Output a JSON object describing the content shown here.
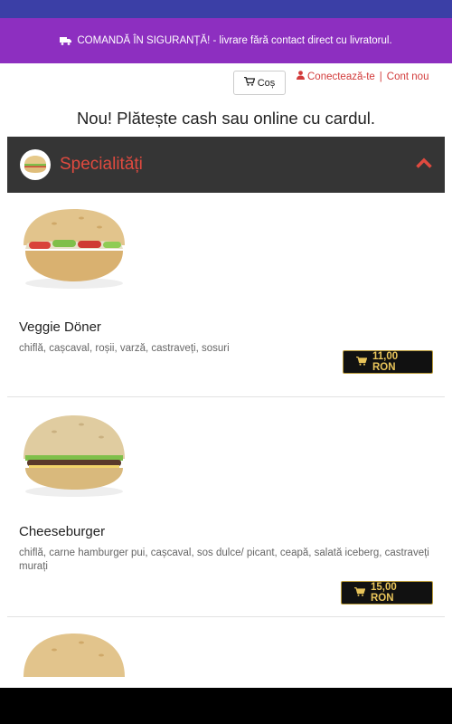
{
  "promo": {
    "text": "COMANDĂ ÎN SIGURANȚĂ! - livrare fără contact direct cu livratorul."
  },
  "header": {
    "cart_label": "Coș",
    "login_label": "Conectează-te",
    "separator": "|",
    "register_label": "Cont nou"
  },
  "notice": "Nou! Plătește cash sau online cu cardul.",
  "category": {
    "title": "Specialități"
  },
  "products": [
    {
      "name": "Veggie Döner",
      "description": "chiflă, cașcaval, roșii, varză, castraveți, sosuri",
      "price": "11,00 RON"
    },
    {
      "name": "Cheeseburger",
      "description": "chiflă, carne hamburger pui, cașcaval, sos dulce/ picant, ceapă, salată iceberg, castraveți murați",
      "price": "15,00 RON"
    }
  ],
  "colors": {
    "topbar": "#3b3fa6",
    "promo": "#8d2fc0",
    "category_bg": "#353535",
    "accent": "#e04a3f",
    "price_text": "#e8c45a"
  }
}
